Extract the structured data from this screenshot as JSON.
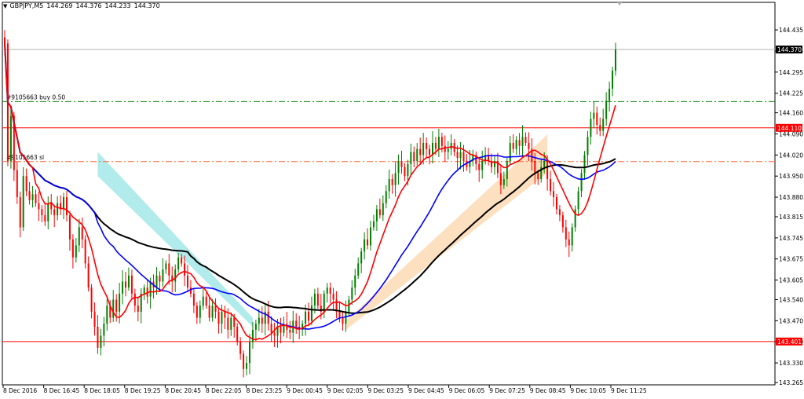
{
  "header": {
    "symbol": "GBPJPY,M5",
    "open": "144.269",
    "high": "144.376",
    "low": "144.233",
    "close": "144.370"
  },
  "colors": {
    "bull": "#008000",
    "bear": "#ff0000",
    "ma_fast": "#ff0000",
    "ma_mid": "#0000ff",
    "ma_slow": "#000000",
    "cloud_bear": "#b2ebeb",
    "cloud_bull": "#fde0c0",
    "level": "#ff0000",
    "buy_line": "#008000",
    "sl_line": "#ff6a3d"
  },
  "chart_data": {
    "type": "candlestick",
    "ylim": [
      143.265,
      144.49
    ],
    "x_ticks": [
      "8 Dec 2016",
      "8 Dec 16:45",
      "8 Dec 18:05",
      "8 Dec 19:25",
      "8 Dec 20:45",
      "8 Dec 22:05",
      "8 Dec 23:25",
      "9 Dec 00:45",
      "9 Dec 02:05",
      "9 Dec 03:25",
      "9 Dec 04:45",
      "9 Dec 06:05",
      "9 Dec 07:25",
      "9 Dec 08:45",
      "9 Dec 10:05",
      "9 Dec 11:25"
    ],
    "y_ticks": [
      "144.435",
      "144.365",
      "144.295",
      "144.225",
      "144.160",
      "144.090",
      "144.020",
      "143.950",
      "143.880",
      "143.815",
      "143.745",
      "143.675",
      "143.605",
      "143.540",
      "143.470",
      "143.400",
      "143.330",
      "143.265"
    ],
    "current_price": "144.370",
    "levels": [
      {
        "label": "144.110",
        "value": 144.11
      },
      {
        "label": "143.401",
        "value": 143.401
      }
    ],
    "orders": [
      {
        "label": "#9105663 buy 0.50",
        "value": 144.197
      },
      {
        "label": "#9105663 sl",
        "value": 143.998
      }
    ],
    "closes": [
      144.39,
      144.0,
      144.15,
      143.97,
      143.88,
      143.78,
      143.95,
      143.9,
      143.87,
      143.89,
      143.86,
      143.84,
      143.82,
      143.8,
      143.86,
      143.84,
      143.82,
      143.86,
      143.84,
      143.88,
      143.82,
      143.74,
      143.68,
      143.72,
      143.78,
      143.74,
      143.66,
      143.58,
      143.5,
      143.45,
      143.38,
      143.42,
      143.46,
      143.52,
      143.48,
      143.54,
      143.5,
      143.56,
      143.6,
      143.58,
      143.62,
      143.56,
      143.52,
      143.5,
      143.56,
      143.58,
      143.55,
      143.6,
      143.58,
      143.62,
      143.6,
      143.64,
      143.66,
      143.62,
      143.6,
      143.64,
      143.68,
      143.66,
      143.62,
      143.58,
      143.56,
      143.52,
      143.48,
      143.52,
      143.55,
      143.52,
      143.48,
      143.52,
      143.5,
      143.46,
      143.5,
      143.48,
      143.44,
      143.48,
      143.45,
      143.4,
      143.36,
      143.31,
      143.33,
      143.4,
      143.44,
      143.46,
      143.48,
      143.46,
      143.5,
      143.46,
      143.43,
      143.42,
      143.45,
      143.43,
      143.46,
      143.44,
      143.43,
      143.47,
      143.45,
      143.44,
      143.46,
      143.5,
      143.47,
      143.52,
      143.56,
      143.52,
      143.5,
      143.56,
      143.58,
      143.56,
      143.54,
      143.5,
      143.48,
      143.46,
      143.5,
      143.54,
      143.58,
      143.62,
      143.66,
      143.7,
      143.74,
      143.72,
      143.78,
      143.8,
      143.84,
      143.82,
      143.86,
      143.9,
      143.94,
      143.92,
      143.96,
      144.0,
      143.98,
      143.95,
      143.99,
      144.03,
      144.0,
      144.04,
      144.02,
      144.06,
      144.04,
      144.02,
      144.06,
      144.04,
      144.08,
      144.05,
      144.03,
      144.04,
      144.06,
      144.03,
      144.01,
      144.03,
      144.0,
      143.98,
      144.0,
      144.02,
      143.99,
      143.97,
      144.0,
      144.02,
      144.0,
      143.98,
      144.0,
      143.96,
      143.92,
      143.94,
      144.0,
      144.06,
      144.04,
      144.07,
      144.05,
      144.08,
      144.06,
      144.04,
      144.0,
      143.96,
      143.94,
      143.98,
      144.0,
      143.94,
      143.9,
      143.88,
      143.84,
      143.82,
      143.78,
      143.74,
      143.72,
      143.78,
      143.84,
      143.9,
      143.96,
      144.02,
      144.08,
      144.14,
      144.16,
      144.12,
      144.1,
      144.14,
      144.2,
      144.24,
      144.3,
      144.37
    ]
  }
}
